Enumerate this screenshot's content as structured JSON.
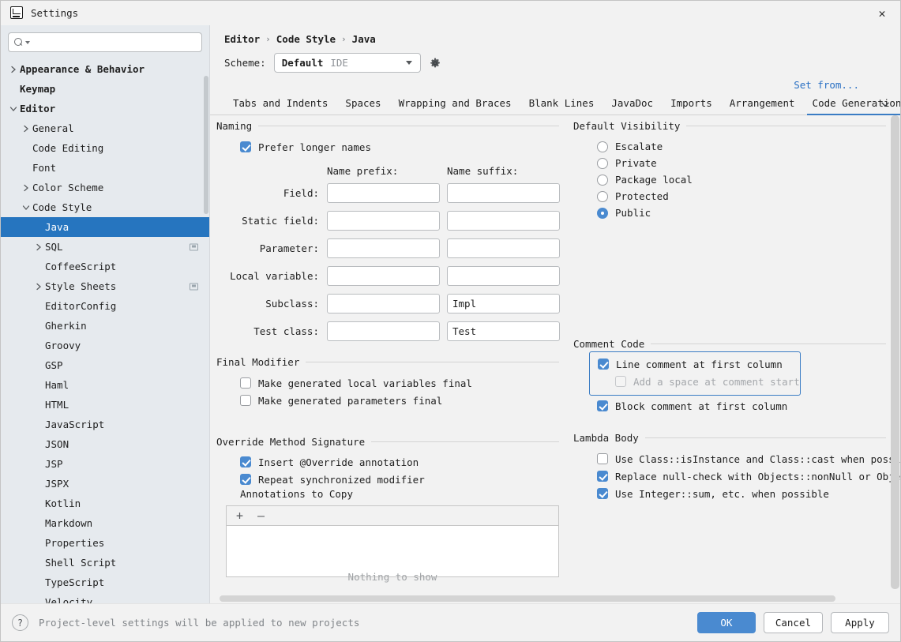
{
  "window": {
    "title": "Settings",
    "app_icon": "intellij-idea-icon",
    "close_icon": "close-icon"
  },
  "sidebar": {
    "search": {
      "placeholder": "",
      "value": "",
      "icon": "search-icon"
    },
    "items": [
      {
        "label": "Appearance & Behavior",
        "arrow": "right",
        "indent": 0,
        "bold": true,
        "selected": false,
        "end_icon": false
      },
      {
        "label": "Keymap",
        "arrow": "none",
        "indent": 0,
        "bold": true,
        "selected": false,
        "end_icon": false
      },
      {
        "label": "Editor",
        "arrow": "down",
        "indent": 0,
        "bold": true,
        "selected": false,
        "end_icon": false
      },
      {
        "label": "General",
        "arrow": "right",
        "indent": 1,
        "bold": false,
        "selected": false,
        "end_icon": false
      },
      {
        "label": "Code Editing",
        "arrow": "none",
        "indent": 1,
        "bold": false,
        "selected": false,
        "end_icon": false
      },
      {
        "label": "Font",
        "arrow": "none",
        "indent": 1,
        "bold": false,
        "selected": false,
        "end_icon": false
      },
      {
        "label": "Color Scheme",
        "arrow": "right",
        "indent": 1,
        "bold": false,
        "selected": false,
        "end_icon": false
      },
      {
        "label": "Code Style",
        "arrow": "down",
        "indent": 1,
        "bold": false,
        "selected": false,
        "end_icon": false
      },
      {
        "label": "Java",
        "arrow": "none",
        "indent": 2,
        "bold": false,
        "selected": true,
        "end_icon": false
      },
      {
        "label": "SQL",
        "arrow": "right",
        "indent": 2,
        "bold": false,
        "selected": false,
        "end_icon": true
      },
      {
        "label": "CoffeeScript",
        "arrow": "none",
        "indent": 2,
        "bold": false,
        "selected": false,
        "end_icon": false
      },
      {
        "label": "Style Sheets",
        "arrow": "right",
        "indent": 2,
        "bold": false,
        "selected": false,
        "end_icon": true
      },
      {
        "label": "EditorConfig",
        "arrow": "none",
        "indent": 2,
        "bold": false,
        "selected": false,
        "end_icon": false
      },
      {
        "label": "Gherkin",
        "arrow": "none",
        "indent": 2,
        "bold": false,
        "selected": false,
        "end_icon": false
      },
      {
        "label": "Groovy",
        "arrow": "none",
        "indent": 2,
        "bold": false,
        "selected": false,
        "end_icon": false
      },
      {
        "label": "GSP",
        "arrow": "none",
        "indent": 2,
        "bold": false,
        "selected": false,
        "end_icon": false
      },
      {
        "label": "Haml",
        "arrow": "none",
        "indent": 2,
        "bold": false,
        "selected": false,
        "end_icon": false
      },
      {
        "label": "HTML",
        "arrow": "none",
        "indent": 2,
        "bold": false,
        "selected": false,
        "end_icon": false
      },
      {
        "label": "JavaScript",
        "arrow": "none",
        "indent": 2,
        "bold": false,
        "selected": false,
        "end_icon": false
      },
      {
        "label": "JSON",
        "arrow": "none",
        "indent": 2,
        "bold": false,
        "selected": false,
        "end_icon": false
      },
      {
        "label": "JSP",
        "arrow": "none",
        "indent": 2,
        "bold": false,
        "selected": false,
        "end_icon": false
      },
      {
        "label": "JSPX",
        "arrow": "none",
        "indent": 2,
        "bold": false,
        "selected": false,
        "end_icon": false
      },
      {
        "label": "Kotlin",
        "arrow": "none",
        "indent": 2,
        "bold": false,
        "selected": false,
        "end_icon": false
      },
      {
        "label": "Markdown",
        "arrow": "none",
        "indent": 2,
        "bold": false,
        "selected": false,
        "end_icon": false
      },
      {
        "label": "Properties",
        "arrow": "none",
        "indent": 2,
        "bold": false,
        "selected": false,
        "end_icon": false
      },
      {
        "label": "Shell Script",
        "arrow": "none",
        "indent": 2,
        "bold": false,
        "selected": false,
        "end_icon": false
      },
      {
        "label": "TypeScript",
        "arrow": "none",
        "indent": 2,
        "bold": false,
        "selected": false,
        "end_icon": false
      },
      {
        "label": "Velocity",
        "arrow": "none",
        "indent": 2,
        "bold": false,
        "selected": false,
        "end_icon": false
      }
    ]
  },
  "main": {
    "breadcrumb": [
      "Editor",
      "Code Style",
      "Java"
    ],
    "breadcrumb_separator": "›",
    "scheme": {
      "label": "Scheme:",
      "value": "Default",
      "scope": "IDE",
      "gear_icon": "gear-icon"
    },
    "set_from_link": "Set from...",
    "tabs": [
      {
        "label": "Tabs and Indents",
        "active": false
      },
      {
        "label": "Spaces",
        "active": false
      },
      {
        "label": "Wrapping and Braces",
        "active": false
      },
      {
        "label": "Blank Lines",
        "active": false
      },
      {
        "label": "JavaDoc",
        "active": false
      },
      {
        "label": "Imports",
        "active": false
      },
      {
        "label": "Arrangement",
        "active": false
      },
      {
        "label": "Code Generation",
        "active": true
      }
    ],
    "tab_overflow_icon": "chevron-down-icon"
  },
  "naming": {
    "group_title": "Naming",
    "prefer_longer_names": {
      "label": "Prefer longer names",
      "checked": true
    },
    "col_prefix": "Name prefix:",
    "col_suffix": "Name suffix:",
    "rows": [
      {
        "label": "Field:",
        "prefix": "",
        "suffix": ""
      },
      {
        "label": "Static field:",
        "prefix": "",
        "suffix": ""
      },
      {
        "label": "Parameter:",
        "prefix": "",
        "suffix": ""
      },
      {
        "label": "Local variable:",
        "prefix": "",
        "suffix": ""
      },
      {
        "label": "Subclass:",
        "prefix": "",
        "suffix": "Impl"
      },
      {
        "label": "Test class:",
        "prefix": "",
        "suffix": "Test"
      }
    ]
  },
  "default_visibility": {
    "group_title": "Default Visibility",
    "options": [
      {
        "label": "Escalate",
        "selected": false
      },
      {
        "label": "Private",
        "selected": false
      },
      {
        "label": "Package local",
        "selected": false
      },
      {
        "label": "Protected",
        "selected": false
      },
      {
        "label": "Public",
        "selected": true
      }
    ]
  },
  "final_modifier": {
    "group_title": "Final Modifier",
    "options": [
      {
        "label": "Make generated local variables final",
        "checked": false
      },
      {
        "label": "Make generated parameters final",
        "checked": false
      }
    ]
  },
  "comment_code": {
    "group_title": "Comment Code",
    "line_comment": {
      "label": "Line comment at first column",
      "checked": true
    },
    "add_space": {
      "label": "Add a space at comment start",
      "checked": false,
      "disabled": true
    },
    "block_comment": {
      "label": "Block comment at first column",
      "checked": true
    }
  },
  "override_method_signature": {
    "group_title": "Override Method Signature",
    "options": [
      {
        "label": "Insert @Override annotation",
        "checked": true
      },
      {
        "label": "Repeat synchronized modifier",
        "checked": true
      }
    ],
    "annotations_label": "Annotations to Copy",
    "toolbar": {
      "add": "+",
      "remove": "–"
    },
    "empty_text": "Nothing to show"
  },
  "lambda_body": {
    "group_title": "Lambda Body",
    "options": [
      {
        "label": "Use Class::isInstance and Class::cast when possible",
        "checked": false
      },
      {
        "label": "Replace null-check with Objects::nonNull or Objects:",
        "checked": true
      },
      {
        "label": "Use Integer::sum, etc. when possible",
        "checked": true
      }
    ]
  },
  "footer": {
    "help_icon": "help-icon",
    "note": "Project-level settings will be applied to new projects",
    "ok": "OK",
    "cancel": "Cancel",
    "apply": "Apply"
  },
  "colors": {
    "accent": "#4a8ad0",
    "selection": "#2675bf",
    "link": "#2b71c4",
    "sidebar_bg": "#e6eaee",
    "panel_bg": "#f2f2f2"
  }
}
